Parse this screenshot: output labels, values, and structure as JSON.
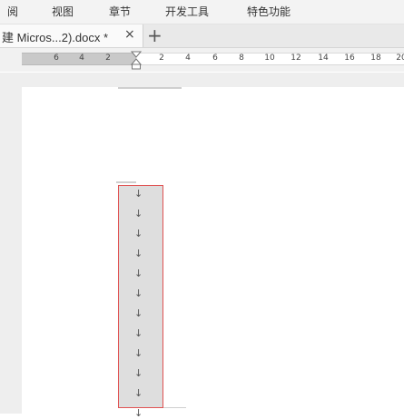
{
  "menu": {
    "items": [
      {
        "label": "阅",
        "name": "menu-review"
      },
      {
        "label": "视图",
        "name": "menu-view"
      },
      {
        "label": "章节",
        "name": "menu-section"
      },
      {
        "label": "开发工具",
        "name": "menu-developer-tools"
      },
      {
        "label": "特色功能",
        "name": "menu-special-features"
      }
    ]
  },
  "tab": {
    "title": "建 Micros...2).docx *",
    "close_icon": "×",
    "new_tab_icon": "+"
  },
  "ruler": {
    "left_labels": [
      "6",
      "4",
      "2"
    ],
    "right_labels": [
      "2",
      "4",
      "6",
      "8",
      "10",
      "12",
      "14",
      "16",
      "18",
      "20"
    ]
  },
  "paragraph_marks": {
    "glyph": "↓",
    "count": 12
  },
  "colors": {
    "selection_border": "#e05252",
    "selection_fill": "#dedede"
  }
}
